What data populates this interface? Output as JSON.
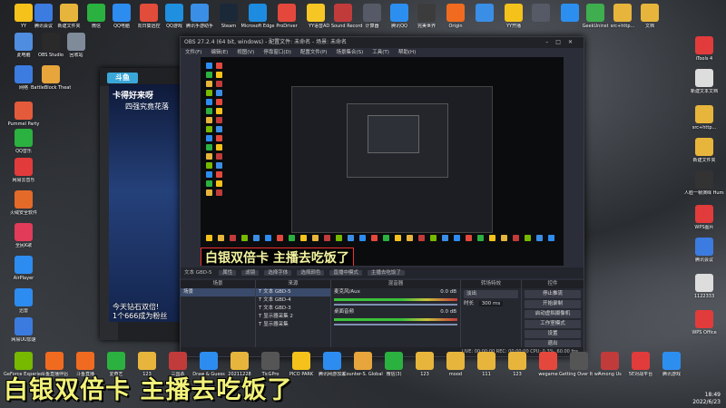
{
  "desktop": {
    "top_icons": [
      {
        "label": "YY",
        "color": "#f4c21b"
      },
      {
        "label": "腾讯会议",
        "color": "#3c7be0"
      },
      {
        "label": "新建文件夹",
        "color": "#e7b53c"
      },
      {
        "label": "微信",
        "color": "#2bb13f"
      },
      {
        "label": "QQ电脑",
        "color": "#2d8cf0"
      },
      {
        "label": "向日葵远控",
        "color": "#e24c3b"
      },
      {
        "label": "QQ游戏",
        "color": "#1f8fe0"
      },
      {
        "label": "腾讯手游助手",
        "color": "#3a8ee6"
      },
      {
        "label": "Steam",
        "color": "#1b2838"
      },
      {
        "label": "Microsoft Edge",
        "color": "#1d8ce0"
      },
      {
        "label": "ProDriver",
        "color": "#e4483d"
      },
      {
        "label": "YY语音",
        "color": "#f6c624"
      },
      {
        "label": "AD Sound Recorder",
        "color": "#c23b3b"
      },
      {
        "label": "计算器",
        "color": "#555a66"
      },
      {
        "label": "腾讯QQ",
        "color": "#2c8ff0"
      },
      {
        "label": "完美世界",
        "color": "#3c3c3c"
      },
      {
        "label": "Origin",
        "color": "#f06b20"
      },
      {
        "label": "",
        "color": "#3a8ee6"
      },
      {
        "label": "YY开播",
        "color": "#f4c21b"
      },
      {
        "label": "",
        "color": "#555a66"
      },
      {
        "label": "",
        "color": "#2c8ff0"
      },
      {
        "label": "GeekUninst",
        "color": "#3fae4f"
      },
      {
        "label": "src+http...",
        "color": "#e7b53c"
      },
      {
        "label": "文档",
        "color": "#e7b53c"
      }
    ],
    "left_icons": [
      {
        "label": "此电脑",
        "color": "#4f8de0"
      },
      {
        "label": "OBS Studio",
        "color": "#2a2a2a"
      },
      {
        "label": "回收站",
        "color": "#7f8b99"
      },
      {
        "label": "网络",
        "color": "#3c7be0"
      },
      {
        "label": "BattleBlock Theater",
        "color": "#e7a53c"
      },
      {
        "label": "Pummel Party",
        "color": "#e45b3b"
      },
      {
        "label": "QQ音乐",
        "color": "#2bb13f"
      },
      {
        "label": "网易云音乐",
        "color": "#e23b3b"
      },
      {
        "label": "火绒安全软件",
        "color": "#e46a2a"
      },
      {
        "label": "全民K歌",
        "color": "#e23b5a"
      },
      {
        "label": "AirPlayer",
        "color": "#2d8cf0"
      },
      {
        "label": "迅雷",
        "color": "#2d8cf0"
      },
      {
        "label": "网易UU加速",
        "color": "#3b7be0"
      }
    ],
    "right_icons": [
      {
        "label": "iTools 4",
        "color": "#e23b3b"
      },
      {
        "label": "新建文本文档",
        "color": "#dddddd"
      },
      {
        "label": "src+http...",
        "color": "#e7b53c"
      },
      {
        "label": "新建文件夹",
        "color": "#e7b53c"
      },
      {
        "label": "人脸一帧演绎 Human Fa...",
        "color": "#333333"
      },
      {
        "label": "WPS图片",
        "color": "#e23b3b"
      },
      {
        "label": "腾讯会议",
        "color": "#3c7be0"
      },
      {
        "label": "1122333",
        "color": "#dddddd"
      },
      {
        "label": "WPS Office",
        "color": "#e23b3b"
      }
    ],
    "taskbar_icons": [
      {
        "label": "GeForce Experience",
        "color": "#76b900"
      },
      {
        "label": "斗鱼直播伴侣",
        "color": "#f06b20"
      },
      {
        "label": "斗鱼直播",
        "color": "#f06b20"
      },
      {
        "label": "爱奇艺",
        "color": "#2bb13f"
      },
      {
        "label": "123",
        "color": "#e7b53c"
      },
      {
        "label": "三国杀",
        "color": "#c23b3b"
      },
      {
        "label": "Draw & Guess",
        "color": "#2d8cf0"
      },
      {
        "label": "20211228",
        "color": "#e7b53c"
      },
      {
        "label": "TicGPro",
        "color": "#555555"
      },
      {
        "label": "PICO PARK",
        "color": "#f4c21b"
      },
      {
        "label": "腾讯网游加速",
        "color": "#2d8cf0"
      },
      {
        "label": "Counter-S. Global Off.",
        "color": "#e7a53c"
      },
      {
        "label": "微信(3)",
        "color": "#2bb13f"
      },
      {
        "label": "123",
        "color": "#e7b53c"
      },
      {
        "label": "mood",
        "color": "#e7b53c"
      },
      {
        "label": "111",
        "color": "#e7b53c"
      },
      {
        "label": "123",
        "color": "#e7b53c"
      },
      {
        "label": "wegame",
        "color": "#e4483d"
      },
      {
        "label": "Getting Over It wi...",
        "color": "#555555"
      },
      {
        "label": "Among Us",
        "color": "#c23b3b"
      },
      {
        "label": "5E对战平台",
        "color": "#e23b3b"
      },
      {
        "label": "腾讯游戏",
        "color": "#2c8ff0"
      }
    ],
    "overlay_caption": "白银双倍卡 主播去吃饭了",
    "clock_time": "18:49",
    "clock_date": "2022/6/23"
  },
  "douyu": {
    "logo": "斗鱼",
    "headline": "卡得好来呀",
    "subline": "四强究竟花落",
    "chat_line1": "今天钻石双倍!",
    "chat_line2": "1个666成为粉丝"
  },
  "obs": {
    "title": "OBS 27.2.4 (64 bit, windows) - 配置文件: 未命名 - 场景: 未命名",
    "menu": [
      "文件(F)",
      "编辑(E)",
      "视图(V)",
      "停靠窗口(D)",
      "配置文件(P)",
      "场景集合(S)",
      "工具(T)",
      "帮助(H)"
    ],
    "preview_caption": "白银双倍卡 主播去吃饭了",
    "text_source_label": "文本 GBD-5",
    "textbar_buttons": [
      "属性",
      "滤镜",
      "选择字体",
      "选择颜色",
      "直播中模式",
      "主播去吃饭了"
    ],
    "docks": {
      "scenes": {
        "title": "场景",
        "items": [
          "场景"
        ]
      },
      "sources": {
        "title": "来源",
        "items": [
          "文本 GBD-5",
          "文本 GBD-4",
          "文本 GBD-3",
          "显示器采集 2",
          "显示器采集"
        ]
      },
      "mixer": {
        "title": "混音器",
        "items": [
          {
            "name": "麦克风/Aux",
            "value": "0.0 dB"
          },
          {
            "name": "桌面音频",
            "value": "0.0 dB"
          }
        ]
      },
      "transitions": {
        "title": "转场特效",
        "type": "淡出",
        "duration_label": "时长",
        "duration": "300 ms"
      },
      "controls": {
        "title": "控件",
        "buttons": [
          "停止推流",
          "开始录制",
          "启动虚拟摄像机",
          "工作室模式",
          "设置",
          "退出"
        ]
      }
    },
    "status": "LIVE: 00:00:00  REC: 00:00:00  CPU: 0.3%, 60.00 fps"
  }
}
